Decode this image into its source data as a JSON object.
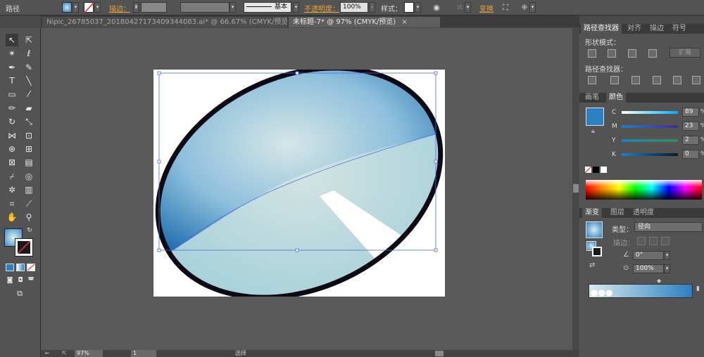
{
  "control_bar": {
    "object_type": "路径",
    "stroke_label": "描边：",
    "stroke_style": "基本",
    "opacity_label": "不透明度：",
    "opacity_value": "100%",
    "style_label": "样式：",
    "transform_label": "变换"
  },
  "documents": {
    "tab1": "Nipic_26785037_20180427173409344083.ai* @ 66.67% (CMYK/预览)",
    "tab2": "未标题-7* @ 97% (CMYK/预览)",
    "close": "×"
  },
  "panels": {
    "pathfinder": {
      "tabs": [
        "路径查找器",
        "对齐",
        "描边",
        "符号"
      ],
      "shape_modes": "形状模式：",
      "expand": "扩展",
      "pathfinders": "路径查找器："
    },
    "color": {
      "tabs": [
        "画笔",
        "颜色"
      ],
      "channels": [
        {
          "name": "C",
          "value": "89"
        },
        {
          "name": "M",
          "value": "23"
        },
        {
          "name": "Y",
          "value": "2"
        },
        {
          "name": "K",
          "value": "0"
        }
      ],
      "unit": "%",
      "fill_color": "#2b7fc2"
    },
    "gradient": {
      "tabs": [
        "渐变",
        "图层",
        "透明度"
      ],
      "type_label": "类型：",
      "type_value": "径向",
      "stroke_label": "描边：",
      "angle": "0°",
      "aspect": "100%"
    }
  },
  "status": {
    "zoom": "97%",
    "page": "1",
    "mode": "选择"
  },
  "colors": {
    "stroke": "#0d0a14",
    "gradient_dark": "#1f6fb0",
    "gradient_light": "#cfe3e6"
  }
}
